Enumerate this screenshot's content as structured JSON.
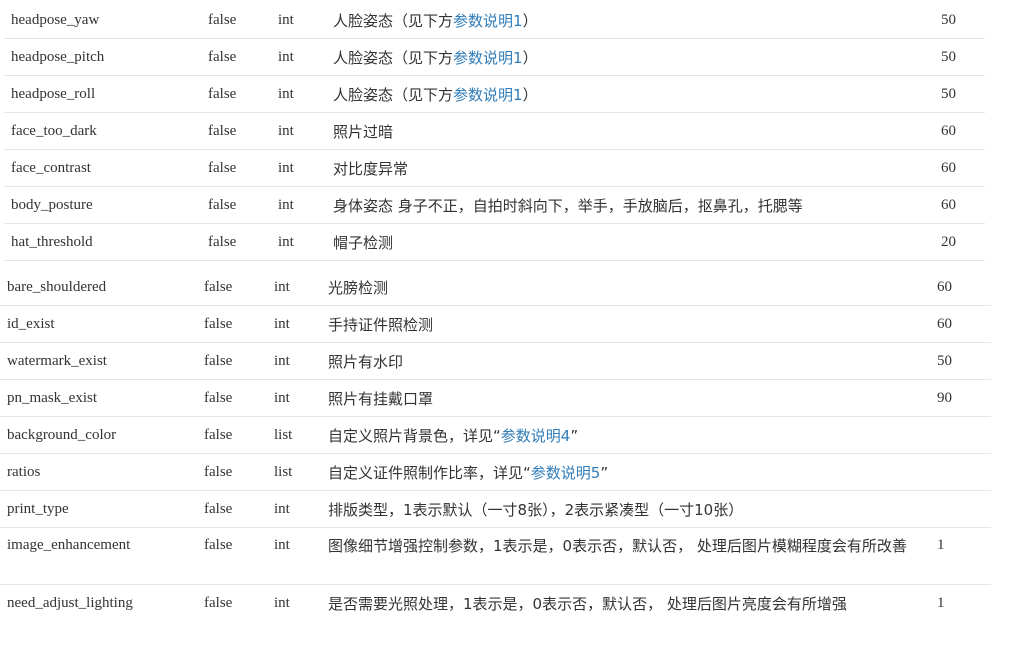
{
  "params_top": [
    {
      "name": "headpose_yaw",
      "required": "false",
      "type": "int",
      "desc_pre": "人脸姿态（见下方",
      "desc_link": "参数说明1",
      "desc_post": "）",
      "default": "50"
    },
    {
      "name": "headpose_pitch",
      "required": "false",
      "type": "int",
      "desc_pre": "人脸姿态（见下方",
      "desc_link": "参数说明1",
      "desc_post": "）",
      "default": "50"
    },
    {
      "name": "headpose_roll",
      "required": "false",
      "type": "int",
      "desc_pre": "人脸姿态（见下方",
      "desc_link": "参数说明1",
      "desc_post": "）",
      "default": "50"
    },
    {
      "name": "face_too_dark",
      "required": "false",
      "type": "int",
      "desc": "照片过暗",
      "default": "60"
    },
    {
      "name": "face_contrast",
      "required": "false",
      "type": "int",
      "desc": "对比度异常",
      "default": "60"
    },
    {
      "name": "body_posture",
      "required": "false",
      "type": "int",
      "desc": "身体姿态 身子不正，自拍时斜向下，举手，手放脑后，抠鼻孔，托腮等",
      "default": "60"
    },
    {
      "name": "hat_threshold",
      "required": "false",
      "type": "int",
      "desc": "帽子检测",
      "default": "20"
    }
  ],
  "params_bottom": [
    {
      "name": "bare_shouldered",
      "required": "false",
      "type": "int",
      "desc": "光膀检测",
      "default": "60"
    },
    {
      "name": "id_exist",
      "required": "false",
      "type": "int",
      "desc": "手持证件照检测",
      "default": "60"
    },
    {
      "name": "watermark_exist",
      "required": "false",
      "type": "int",
      "desc": "照片有水印",
      "default": "50"
    },
    {
      "name": "pn_mask_exist",
      "required": "false",
      "type": "int",
      "desc": "照片有挂戴口罩",
      "default": "90"
    },
    {
      "name": "background_color",
      "required": "false",
      "type": "list",
      "desc_pre": "自定义照片背景色，详见“",
      "desc_link": "参数说明4",
      "desc_post": "”",
      "default": ""
    },
    {
      "name": "ratios",
      "required": "false",
      "type": "list",
      "desc_pre": "自定义证件照制作比率，详见“",
      "desc_link": "参数说明5",
      "desc_post": "”",
      "default": ""
    },
    {
      "name": "print_type",
      "required": "false",
      "type": "int",
      "desc": "排版类型，1表示默认（一寸8张），2表示紧凑型（一寸10张）",
      "default": ""
    },
    {
      "name": "image_enhancement",
      "required": "false",
      "type": "int",
      "desc": "图像细节增强控制参数，1表示是，0表示否，默认否， 处理后图片模糊程度会有所改善",
      "default": "1"
    },
    {
      "name": "need_adjust_lighting",
      "required": "false",
      "type": "int",
      "desc": "是否需要光照处理，1表示是，0表示否，默认否， 处理后图片亮度会有所增强",
      "default": "1"
    }
  ],
  "colors": {
    "link": "#2f7cb8",
    "text": "#333333",
    "border": "#e5e5e5"
  }
}
